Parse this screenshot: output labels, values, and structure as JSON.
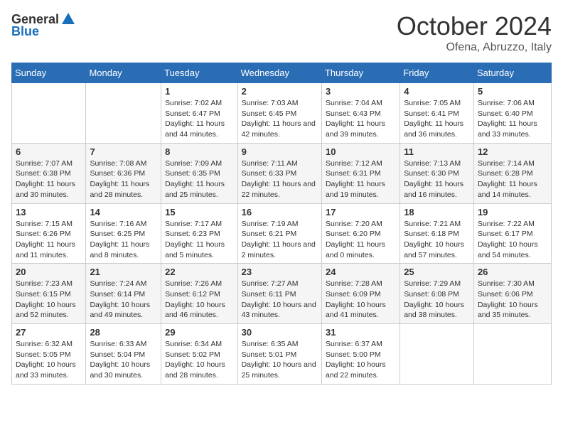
{
  "header": {
    "logo_general": "General",
    "logo_blue": "Blue",
    "month": "October 2024",
    "location": "Ofena, Abruzzo, Italy"
  },
  "columns": [
    "Sunday",
    "Monday",
    "Tuesday",
    "Wednesday",
    "Thursday",
    "Friday",
    "Saturday"
  ],
  "weeks": [
    [
      {
        "day": "",
        "info": ""
      },
      {
        "day": "",
        "info": ""
      },
      {
        "day": "1",
        "info": "Sunrise: 7:02 AM\nSunset: 6:47 PM\nDaylight: 11 hours and 44 minutes."
      },
      {
        "day": "2",
        "info": "Sunrise: 7:03 AM\nSunset: 6:45 PM\nDaylight: 11 hours and 42 minutes."
      },
      {
        "day": "3",
        "info": "Sunrise: 7:04 AM\nSunset: 6:43 PM\nDaylight: 11 hours and 39 minutes."
      },
      {
        "day": "4",
        "info": "Sunrise: 7:05 AM\nSunset: 6:41 PM\nDaylight: 11 hours and 36 minutes."
      },
      {
        "day": "5",
        "info": "Sunrise: 7:06 AM\nSunset: 6:40 PM\nDaylight: 11 hours and 33 minutes."
      }
    ],
    [
      {
        "day": "6",
        "info": "Sunrise: 7:07 AM\nSunset: 6:38 PM\nDaylight: 11 hours and 30 minutes."
      },
      {
        "day": "7",
        "info": "Sunrise: 7:08 AM\nSunset: 6:36 PM\nDaylight: 11 hours and 28 minutes."
      },
      {
        "day": "8",
        "info": "Sunrise: 7:09 AM\nSunset: 6:35 PM\nDaylight: 11 hours and 25 minutes."
      },
      {
        "day": "9",
        "info": "Sunrise: 7:11 AM\nSunset: 6:33 PM\nDaylight: 11 hours and 22 minutes."
      },
      {
        "day": "10",
        "info": "Sunrise: 7:12 AM\nSunset: 6:31 PM\nDaylight: 11 hours and 19 minutes."
      },
      {
        "day": "11",
        "info": "Sunrise: 7:13 AM\nSunset: 6:30 PM\nDaylight: 11 hours and 16 minutes."
      },
      {
        "day": "12",
        "info": "Sunrise: 7:14 AM\nSunset: 6:28 PM\nDaylight: 11 hours and 14 minutes."
      }
    ],
    [
      {
        "day": "13",
        "info": "Sunrise: 7:15 AM\nSunset: 6:26 PM\nDaylight: 11 hours and 11 minutes."
      },
      {
        "day": "14",
        "info": "Sunrise: 7:16 AM\nSunset: 6:25 PM\nDaylight: 11 hours and 8 minutes."
      },
      {
        "day": "15",
        "info": "Sunrise: 7:17 AM\nSunset: 6:23 PM\nDaylight: 11 hours and 5 minutes."
      },
      {
        "day": "16",
        "info": "Sunrise: 7:19 AM\nSunset: 6:21 PM\nDaylight: 11 hours and 2 minutes."
      },
      {
        "day": "17",
        "info": "Sunrise: 7:20 AM\nSunset: 6:20 PM\nDaylight: 11 hours and 0 minutes."
      },
      {
        "day": "18",
        "info": "Sunrise: 7:21 AM\nSunset: 6:18 PM\nDaylight: 10 hours and 57 minutes."
      },
      {
        "day": "19",
        "info": "Sunrise: 7:22 AM\nSunset: 6:17 PM\nDaylight: 10 hours and 54 minutes."
      }
    ],
    [
      {
        "day": "20",
        "info": "Sunrise: 7:23 AM\nSunset: 6:15 PM\nDaylight: 10 hours and 52 minutes."
      },
      {
        "day": "21",
        "info": "Sunrise: 7:24 AM\nSunset: 6:14 PM\nDaylight: 10 hours and 49 minutes."
      },
      {
        "day": "22",
        "info": "Sunrise: 7:26 AM\nSunset: 6:12 PM\nDaylight: 10 hours and 46 minutes."
      },
      {
        "day": "23",
        "info": "Sunrise: 7:27 AM\nSunset: 6:11 PM\nDaylight: 10 hours and 43 minutes."
      },
      {
        "day": "24",
        "info": "Sunrise: 7:28 AM\nSunset: 6:09 PM\nDaylight: 10 hours and 41 minutes."
      },
      {
        "day": "25",
        "info": "Sunrise: 7:29 AM\nSunset: 6:08 PM\nDaylight: 10 hours and 38 minutes."
      },
      {
        "day": "26",
        "info": "Sunrise: 7:30 AM\nSunset: 6:06 PM\nDaylight: 10 hours and 35 minutes."
      }
    ],
    [
      {
        "day": "27",
        "info": "Sunrise: 6:32 AM\nSunset: 5:05 PM\nDaylight: 10 hours and 33 minutes."
      },
      {
        "day": "28",
        "info": "Sunrise: 6:33 AM\nSunset: 5:04 PM\nDaylight: 10 hours and 30 minutes."
      },
      {
        "day": "29",
        "info": "Sunrise: 6:34 AM\nSunset: 5:02 PM\nDaylight: 10 hours and 28 minutes."
      },
      {
        "day": "30",
        "info": "Sunrise: 6:35 AM\nSunset: 5:01 PM\nDaylight: 10 hours and 25 minutes."
      },
      {
        "day": "31",
        "info": "Sunrise: 6:37 AM\nSunset: 5:00 PM\nDaylight: 10 hours and 22 minutes."
      },
      {
        "day": "",
        "info": ""
      },
      {
        "day": "",
        "info": ""
      }
    ]
  ]
}
